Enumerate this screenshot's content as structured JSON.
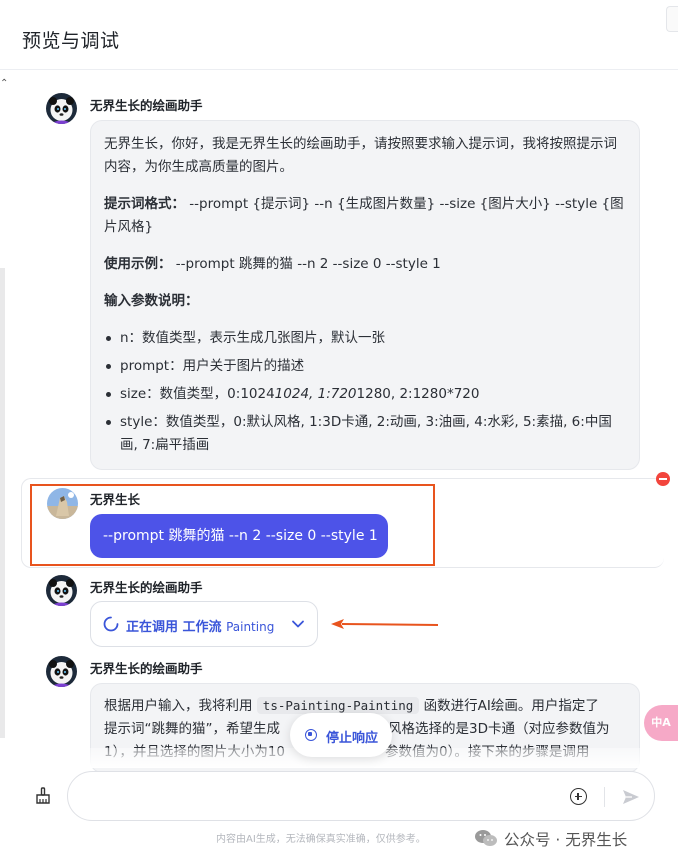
{
  "header": {
    "title": "预览与调试"
  },
  "messages": [
    {
      "sender": "无界生长的绘画助手",
      "intro": "无界生长，你好，我是无界生长的绘画助手，请按照要求输入提示词，我将按照提示词内容，为你生成高质量的图片。",
      "format_label": "提示词格式：",
      "format_text": " --prompt {提示词} --n {生成图片数量} --size {图片大小} --style {图片风格}",
      "example_label": "使用示例：",
      "example_text": " --prompt 跳舞的猫 --n 2 --size 0 --style 1",
      "params_label": "输入参数说明：",
      "params": [
        {
          "head": "n：数值类型，表示生成几张图片，默认一张"
        },
        {
          "head": "prompt：用户关于图片的描述"
        },
        {
          "head": "size：数值类型，0:1024",
          "italic": "1024, 1:720",
          "tail": "1280, 2:1280*720"
        },
        {
          "head": "style：数值类型，0:默认风格, 1:3D卡通, 2:动画, 3:油画, 4:水彩, 5:素描, 6:中国画, 7:扁平插画"
        }
      ]
    },
    {
      "sender": "无界生长",
      "text": "--prompt 跳舞的猫 --n 2 --size 0 --style 1"
    },
    {
      "sender": "无界生长的绘画助手",
      "workflow_status": "正在调用 工作流",
      "workflow_name": "Painting"
    },
    {
      "sender": "无界生长的绘画助手",
      "text_a": "根据用户输入，我将利用",
      "code": "ts-Painting-Painting",
      "text_b": "函数进行AI绘画。用户指定了",
      "line2_a": "提示词“跳舞的猫”，希望生成",
      "line2_b": "风格选择的是3D卡通（对应参数值为",
      "line3_a": "1），并且选择的图片大小为10",
      "line3_b": "参数值为0）。接下来的步骤是调用"
    }
  ],
  "stop_button": {
    "label": "停止响应"
  },
  "translate_fab": {
    "label": "中A"
  },
  "composer": {
    "placeholder": "",
    "value": ""
  },
  "footer": {
    "disclaimer": "内容由AI生成，无法确保真实准确，仅供参考。",
    "watermark": "公众号 · 无界生长"
  },
  "colors": {
    "accent": "#4d53e8",
    "link": "#3a55d9",
    "annotation": "#e8541e",
    "danger": "#f2453d"
  }
}
